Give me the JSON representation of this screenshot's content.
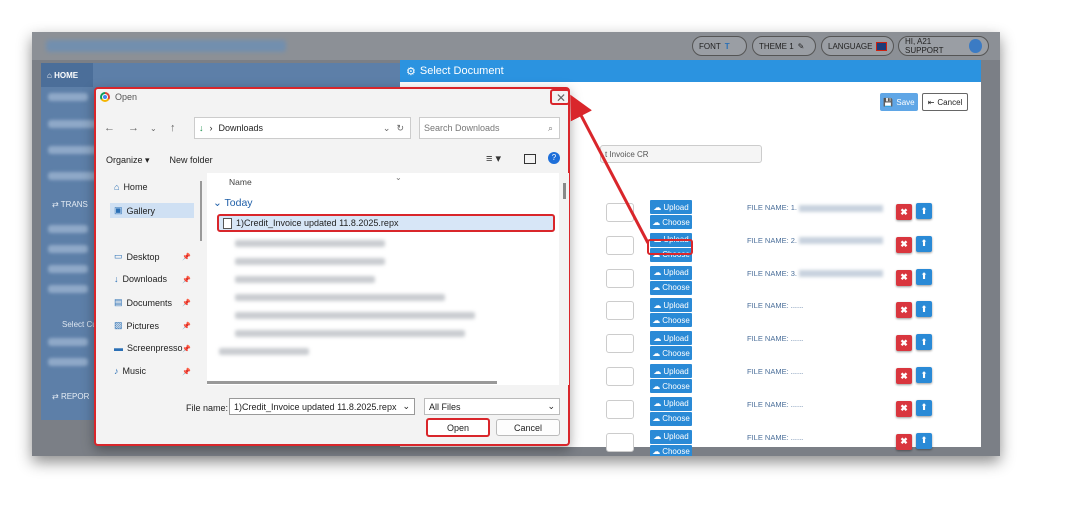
{
  "app": {
    "home_tab": "HOME",
    "sidebar_trans": "TRANS",
    "sidebar_report": "REPOR",
    "sidebar_select": "Select Cu",
    "pills": [
      {
        "label": "FONT",
        "icon": "font-icon"
      },
      {
        "label": "THEME 1",
        "icon": "theme-icon"
      },
      {
        "label": "LANGUAGE",
        "icon": "uk-flag-icon"
      },
      {
        "label": "HI, A21 SUPPORT",
        "icon": "user-avatar-icon"
      }
    ]
  },
  "select_document": {
    "title": "Select Document",
    "save_label": "Save",
    "cancel_label": "Cancel",
    "template_value": "t Invoice CR",
    "upload_label": "Upload",
    "choose_label": "Choose",
    "delete_glyph": "✖",
    "download_glyph": "⬆",
    "rows": [
      {
        "file_name": "FILE NAME: 1."
      },
      {
        "file_name": "FILE NAME: 2."
      },
      {
        "file_name": "FILE NAME: 3."
      },
      {
        "file_name": "FILE NAME: ......"
      },
      {
        "file_name": "FILE NAME: ......"
      },
      {
        "file_name": "FILE NAME: ......"
      },
      {
        "file_name": "FILE NAME: ......"
      },
      {
        "file_name": "FILE NAME: ......"
      }
    ]
  },
  "open_dialog": {
    "title": "Open",
    "path_label": "Downloads",
    "search_placeholder": "Search Downloads",
    "organize_label": "Organize ▾",
    "new_folder_label": "New folder",
    "nav_items": [
      {
        "label": "Home",
        "icon": "home-icon"
      },
      {
        "label": "Gallery",
        "icon": "gallery-icon"
      },
      {
        "label": "Desktop",
        "icon": "desktop-icon"
      },
      {
        "label": "Downloads",
        "icon": "downloads-icon"
      },
      {
        "label": "Documents",
        "icon": "documents-icon"
      },
      {
        "label": "Pictures",
        "icon": "pictures-icon"
      },
      {
        "label": "Screenpresso",
        "icon": "folder-icon"
      },
      {
        "label": "Music",
        "icon": "music-icon"
      }
    ],
    "column_name": "Name",
    "group_today": "Today",
    "selected_file": "1)Credit_Invoice updated 11.8.2025.repx",
    "file_name_label": "File name:",
    "file_name_value": "1)Credit_Invoice updated 11.8.2025.repx",
    "filter_value": "All Files",
    "open_label": "Open",
    "cancel_label": "Cancel"
  },
  "colors": {
    "accent": "#2b93e0",
    "highlight": "#d9262b",
    "delete": "#d9363e"
  }
}
